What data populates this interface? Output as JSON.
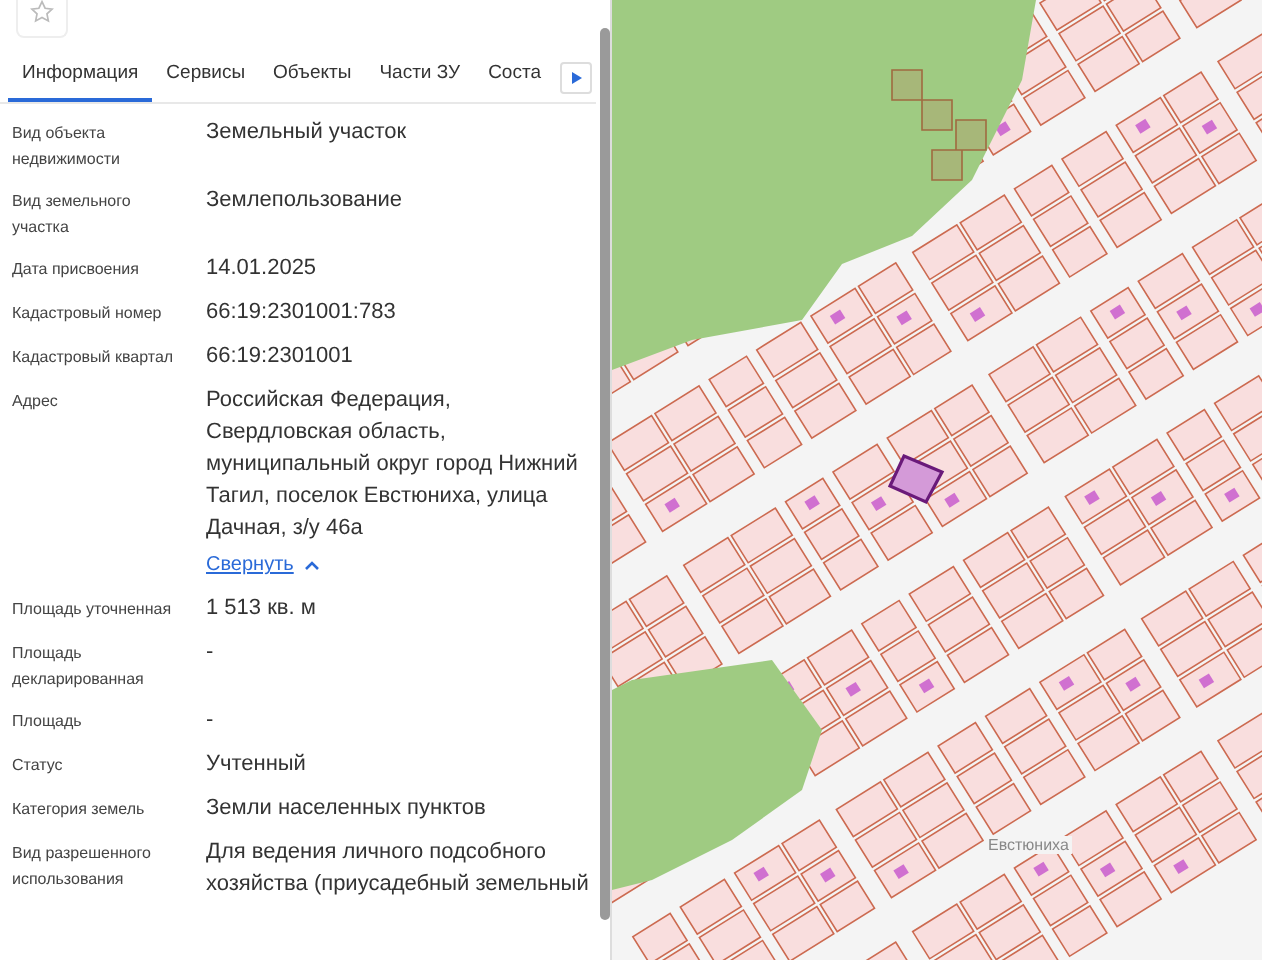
{
  "tabs": [
    {
      "label": "Информация",
      "selected": true
    },
    {
      "label": "Сервисы",
      "selected": false
    },
    {
      "label": "Объекты",
      "selected": false
    },
    {
      "label": "Части ЗУ",
      "selected": false
    },
    {
      "label": "Соста",
      "selected": false
    }
  ],
  "rows": [
    {
      "label": "Вид объекта недвижимости",
      "value": "Земельный участок"
    },
    {
      "label": "Вид земельного участка",
      "value": "Землепользование"
    },
    {
      "label": "Дата присвоения",
      "value": "14.01.2025"
    },
    {
      "label": "Кадастровый номер",
      "value": "66:19:2301001:783"
    },
    {
      "label": "Кадастровый квартал",
      "value": "66:19:2301001"
    },
    {
      "label": "Адрес",
      "value": "Российская Федерация, Свердловская область, муниципальный округ город Нижний Тагил, поселок Евстюниха, улица Дачная, з/у 46а",
      "link": "Свернуть"
    },
    {
      "label": "Площадь уточненная",
      "value": "1 513 кв. м"
    },
    {
      "label": "Площадь декларированная",
      "value": "-"
    },
    {
      "label": "Площадь",
      "value": "-"
    },
    {
      "label": "Статус",
      "value": "Учтенный"
    },
    {
      "label": "Категория земель",
      "value": "Земли населенных пунктов"
    },
    {
      "label": "Вид разрешенного использования",
      "value": "Для ведения личного подсобного хозяйства (приусадебный земельный"
    }
  ],
  "map": {
    "place_label": "Евстюниха"
  }
}
